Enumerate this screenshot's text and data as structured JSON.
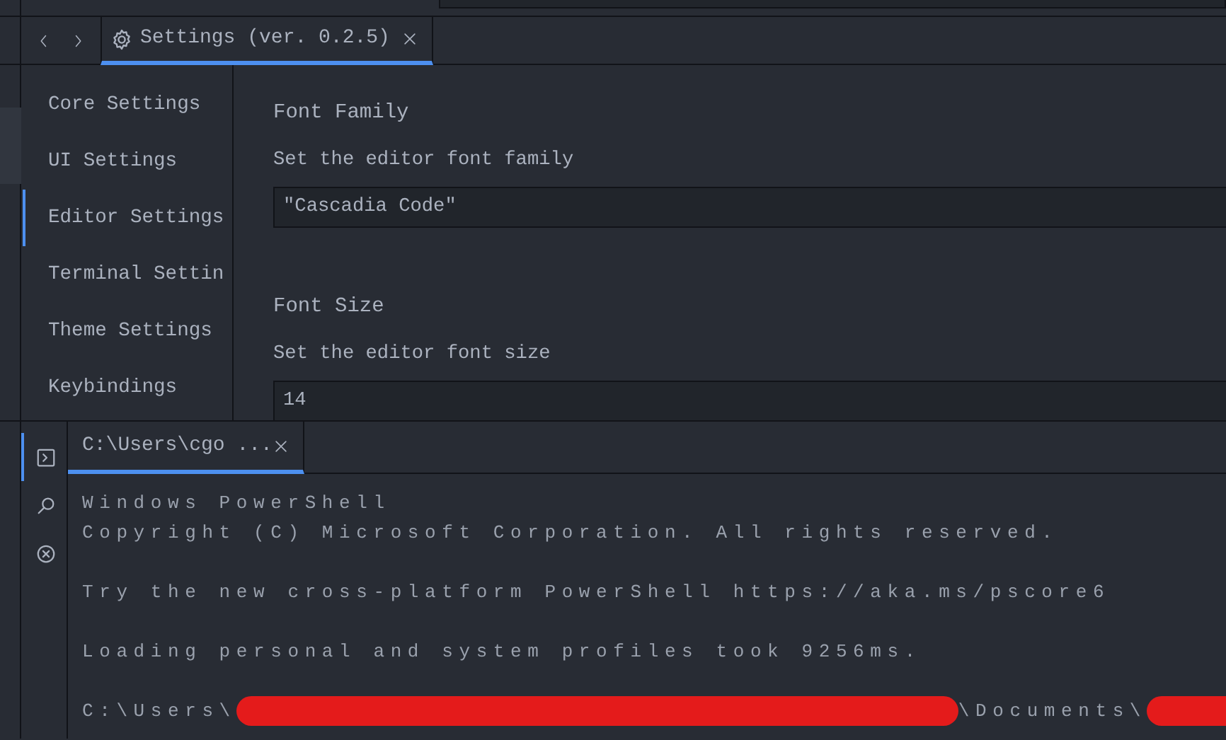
{
  "editor_tabs": {
    "tabs": [
      {
        "label": "Settings (ver. 0.2.5)",
        "selected": true
      }
    ]
  },
  "settings": {
    "sidebar": [
      {
        "label": "Core Settings",
        "selected": false
      },
      {
        "label": "UI Settings",
        "selected": false
      },
      {
        "label": "Editor Settings",
        "selected": true
      },
      {
        "label": "Terminal Settin",
        "selected": false
      },
      {
        "label": "Theme Settings",
        "selected": false
      },
      {
        "label": "Keybindings",
        "selected": false
      }
    ],
    "fields": [
      {
        "title": "Font Family",
        "description": "Set the editor font family",
        "value": "\"Cascadia Code\""
      },
      {
        "title": "Font Size",
        "description": "Set the editor font size",
        "value": "14"
      }
    ]
  },
  "panel": {
    "side_icons": [
      {
        "kind": "terminal",
        "selected": true
      },
      {
        "kind": "search",
        "selected": false
      },
      {
        "kind": "problems",
        "selected": false
      }
    ],
    "tabs": [
      {
        "label": "C:\\Users\\cgo ...",
        "selected": true
      }
    ],
    "terminal": {
      "blocks": [
        [
          "Windows PowerShell",
          "Copyright (C) Microsoft Corporation. All rights reserved."
        ],
        [
          "Try the new cross-platform PowerShell https://aka.ms/pscore6"
        ],
        [
          "Loading personal and system profiles took 9256ms."
        ]
      ],
      "prompt": [
        {
          "kind": "text",
          "text": "C:\\Users\\"
        },
        {
          "kind": "redaction"
        },
        {
          "kind": "text",
          "text": "\\Documents\\"
        },
        {
          "kind": "redaction"
        }
      ]
    }
  }
}
